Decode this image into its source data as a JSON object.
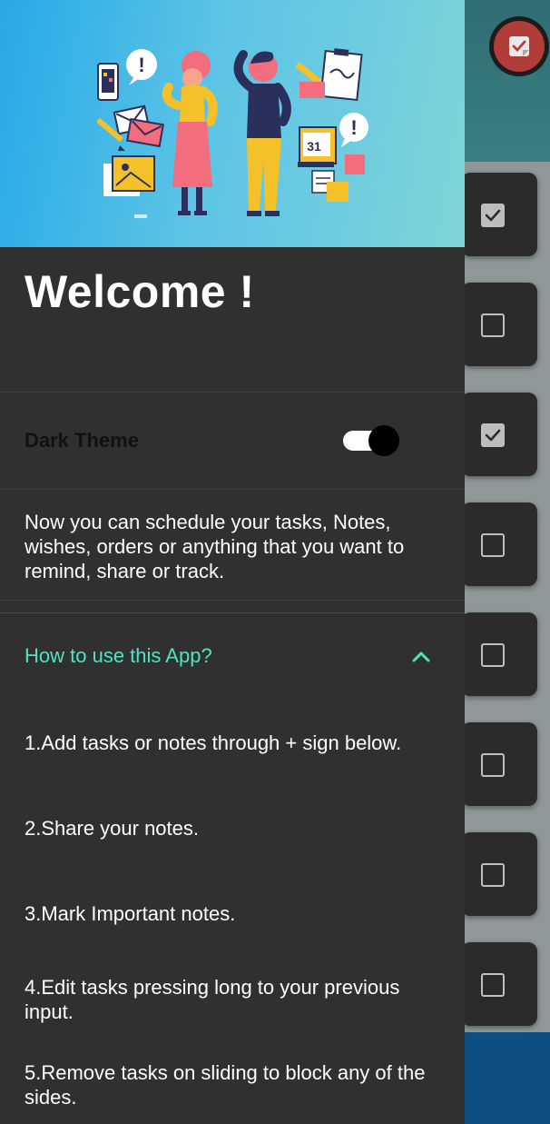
{
  "drawer": {
    "welcome_title": "Welcome !",
    "dark_theme_label": "Dark Theme",
    "dark_theme_enabled": true,
    "intro_text": "Now you can schedule your tasks, Notes, wishes, orders or anything that you want to remind, share or track.",
    "howto": {
      "title": "How to use this App?",
      "expanded": true,
      "steps": [
        "1.Add tasks or notes through + sign below.",
        "2.Share your notes.",
        "3.Mark Important notes.",
        "4.Edit tasks pressing long to your previous input.",
        "5.Remove tasks on sliding to block any of the sides."
      ]
    },
    "illustration": {
      "calendar_day": "31",
      "bubble_marks": [
        "!",
        "!"
      ]
    }
  },
  "background": {
    "tasks": [
      {
        "checked": true
      },
      {
        "checked": false
      },
      {
        "checked": true
      },
      {
        "checked": false
      },
      {
        "checked": false
      },
      {
        "checked": false
      },
      {
        "checked": false
      },
      {
        "checked": false
      }
    ]
  },
  "colors": {
    "drawer_bg": "#303030",
    "accent": "#4fe3c4",
    "fab_red": "#b23c37",
    "bottom_bar": "#0d4f82"
  },
  "icons": {
    "fab": "note-check-icon",
    "expand": "chevron-up-icon",
    "task_checkbox": "checkbox-icon"
  }
}
